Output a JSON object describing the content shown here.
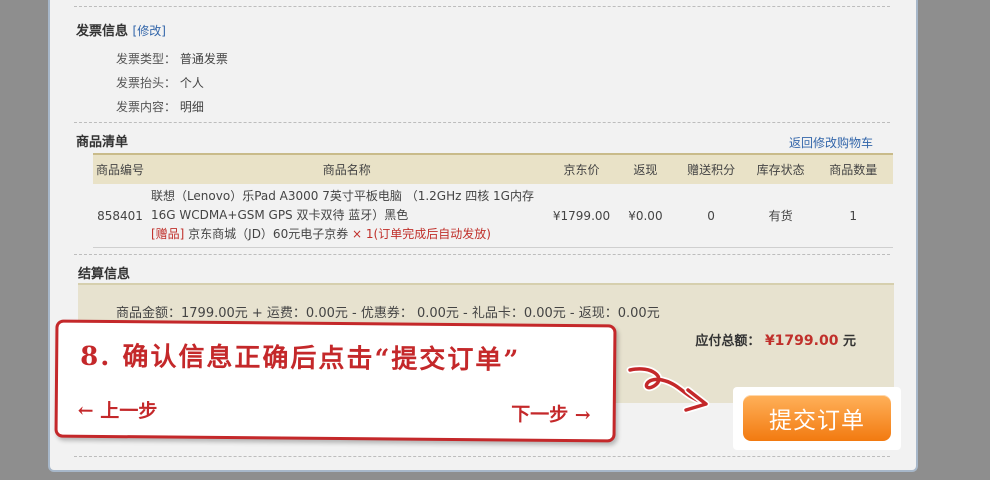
{
  "invoice": {
    "title": "发票信息",
    "edit_link": "[修改]",
    "rows": [
      {
        "label": "发票类型：",
        "value": "普通发票"
      },
      {
        "label": "发票抬头：",
        "value": "个人"
      },
      {
        "label": "发票内容：",
        "value": "明细"
      }
    ]
  },
  "goods": {
    "title": "商品清单",
    "back_link": "返回修改购物车",
    "headers": [
      "商品编号",
      "商品名称",
      "京东价",
      "返现",
      "赠送积分",
      "库存状态",
      "商品数量"
    ],
    "item": {
      "id": "858401",
      "name_line1": "联想（Lenovo）乐Pad A3000 7英寸平板电脑 （1.2GHz 四核 1G内存",
      "name_line2": "16G WCDMA+GSM GPS 双卡双待 蓝牙）黑色",
      "gift_tag": "[赠品]",
      "gift_text": "京东商城（JD）60元电子京券",
      "gift_qty": "× 1(订单完成后自动发放)",
      "price": "¥1799.00",
      "cashback": "¥0.00",
      "points": "0",
      "stock": "有货",
      "qty": "1"
    }
  },
  "settle": {
    "title": "结算信息",
    "summary": "商品金额：1799.00元 + 运费：0.00元 - 优惠券： 0.00元 - 礼品卡：0.00元 - 返现：0.00元",
    "payable_label": "应付总额：",
    "payable_amount": "¥1799.00",
    "payable_unit": "元"
  },
  "submit": {
    "label": "提交订单"
  },
  "tutorial": {
    "text": "8. 确认信息正确后点击“提交订单”",
    "prev": "← 上一步",
    "next": "下一步 →",
    "color": "#c4282a"
  },
  "colors": {
    "accent_red": "#c0302b",
    "link_blue": "#3366aa",
    "button_orange": "#f27a10"
  }
}
